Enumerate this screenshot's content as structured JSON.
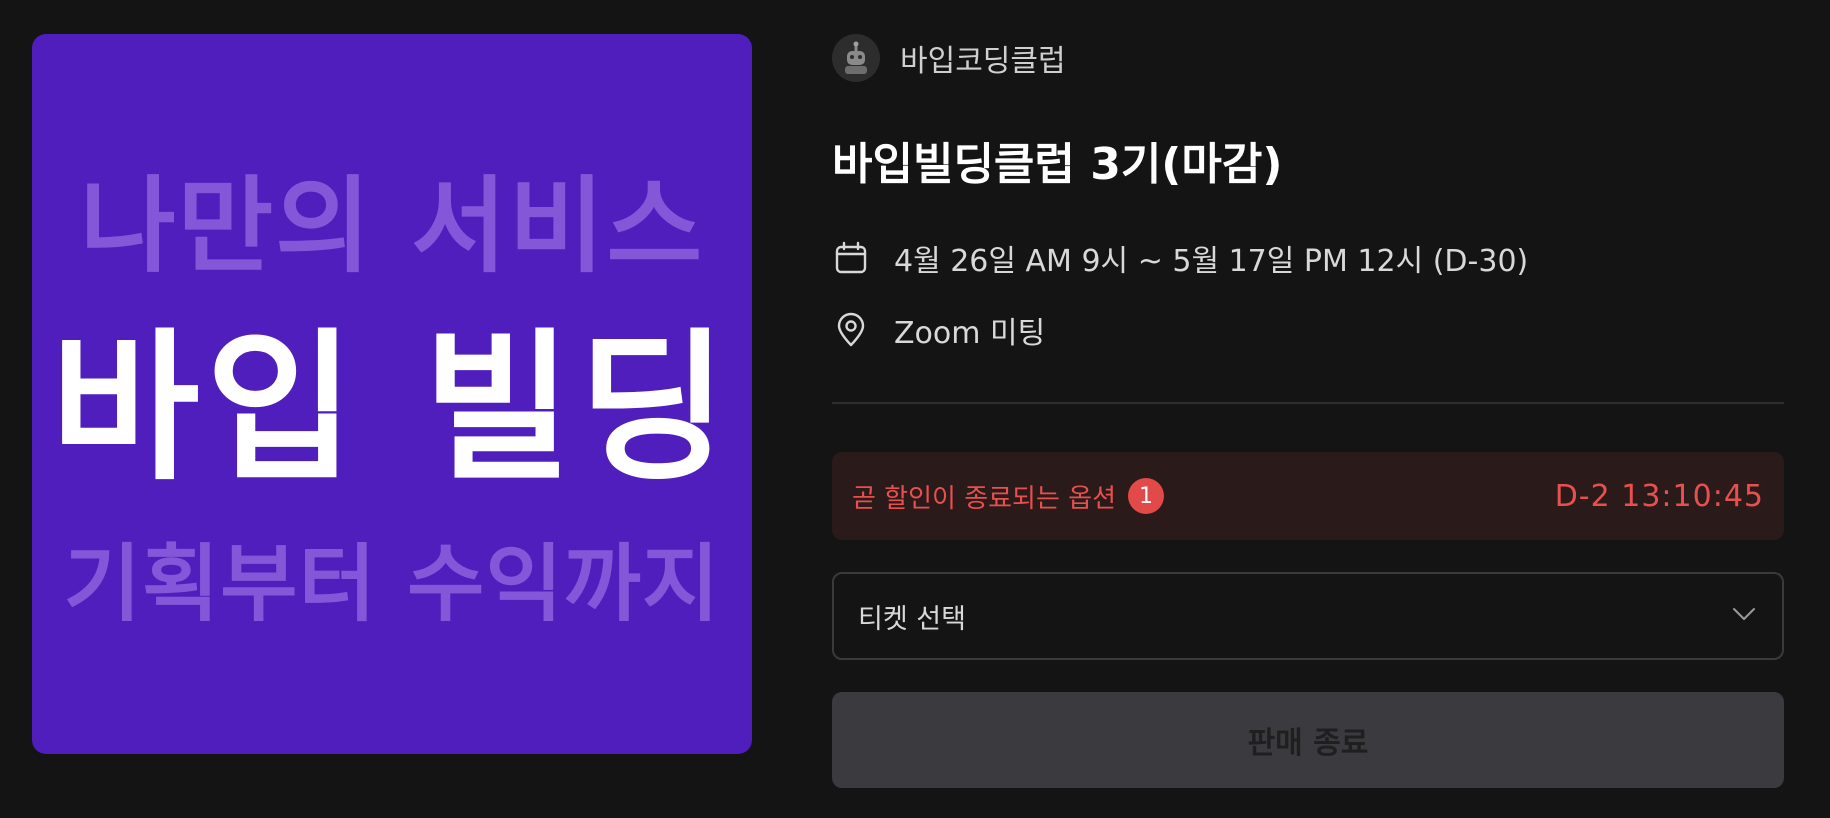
{
  "poster": {
    "line_top": "나만의 서비스",
    "line_main": "바입 빌딩",
    "line_bottom": "기획부터 수익까지",
    "background_color": "#511ebe"
  },
  "host": {
    "name": "바입코딩클럽",
    "avatar_icon": "robot-avatar-icon"
  },
  "event": {
    "title": "바입빌딩클럽 3기(마감)",
    "date_text": "4월 26일 AM 9시 ~ 5월 17일 PM 12시 (D-30)",
    "date_icon": "calendar-icon",
    "location_text": "Zoom 미팅",
    "location_icon": "location-pin-icon"
  },
  "discount": {
    "text": "곧 할인이 종료되는 옵션",
    "badge_count": "1",
    "timer": "D-2 13:10:45",
    "accent_color": "#e8504f"
  },
  "ticket_select": {
    "label": "티켓 선택",
    "icon": "chevron-down-icon"
  },
  "buy_button": {
    "label": "판매 종료"
  }
}
